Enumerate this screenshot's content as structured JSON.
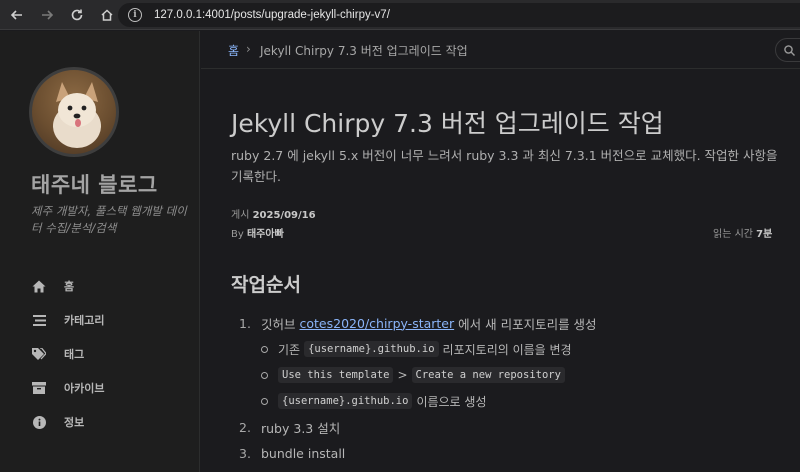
{
  "browser": {
    "url": "127.0.0.1:4001/posts/upgrade-jekyll-chirpy-v7/"
  },
  "sidebar": {
    "blog_title": "태주네 블로그",
    "subtitle": "제주 개발자, 풀스택 웹개발 데이터 수집/분석/검색",
    "items": [
      {
        "label": "홈",
        "icon": "home-icon"
      },
      {
        "label": "카테고리",
        "icon": "stream-icon"
      },
      {
        "label": "태그",
        "icon": "tags-icon"
      },
      {
        "label": "아카이브",
        "icon": "archive-icon"
      },
      {
        "label": "정보",
        "icon": "info-icon"
      }
    ]
  },
  "topbar": {
    "breadcrumb_home": "홈",
    "breadcrumb_sep": "›",
    "breadcrumb_current": "Jekyll Chirpy 7.3 버전 업그레이드 작업"
  },
  "post": {
    "title": "Jekyll Chirpy 7.3 버전 업그레이드 작업",
    "description": "ruby 2.7 에 jekyll 5.x 버전이 너무 느려서 ruby 3.3 과 최신 7.3.1 버전으로 교체했다. 작업한 사항을 기록한다.",
    "posted_label": "게시",
    "posted_date": "2025/09/16",
    "by_label": "By",
    "author": "태주아빠",
    "read_label": "읽는 시간",
    "read_time": "7분",
    "section_heading": "작업순서",
    "step1_num": "1.",
    "step1_prefix": "깃허브",
    "step1_link": "cotes2020/chirpy-starter",
    "step1_suffix": "에서 새 리포지토리를 생성",
    "sub1_pre": "기존",
    "sub1_code": "{username}.github.io",
    "sub1_post": "리포지토리의 이름을 변경",
    "sub2_code1": "Use this template",
    "sub2_gt": ">",
    "sub2_code2": "Create a new repository",
    "sub3_code": "{username}.github.io",
    "sub3_post": "이름으로 생성",
    "step2_num": "2.",
    "step2_text": "ruby 3.3 설치",
    "step3_num": "3.",
    "step3_text": "bundle install"
  }
}
